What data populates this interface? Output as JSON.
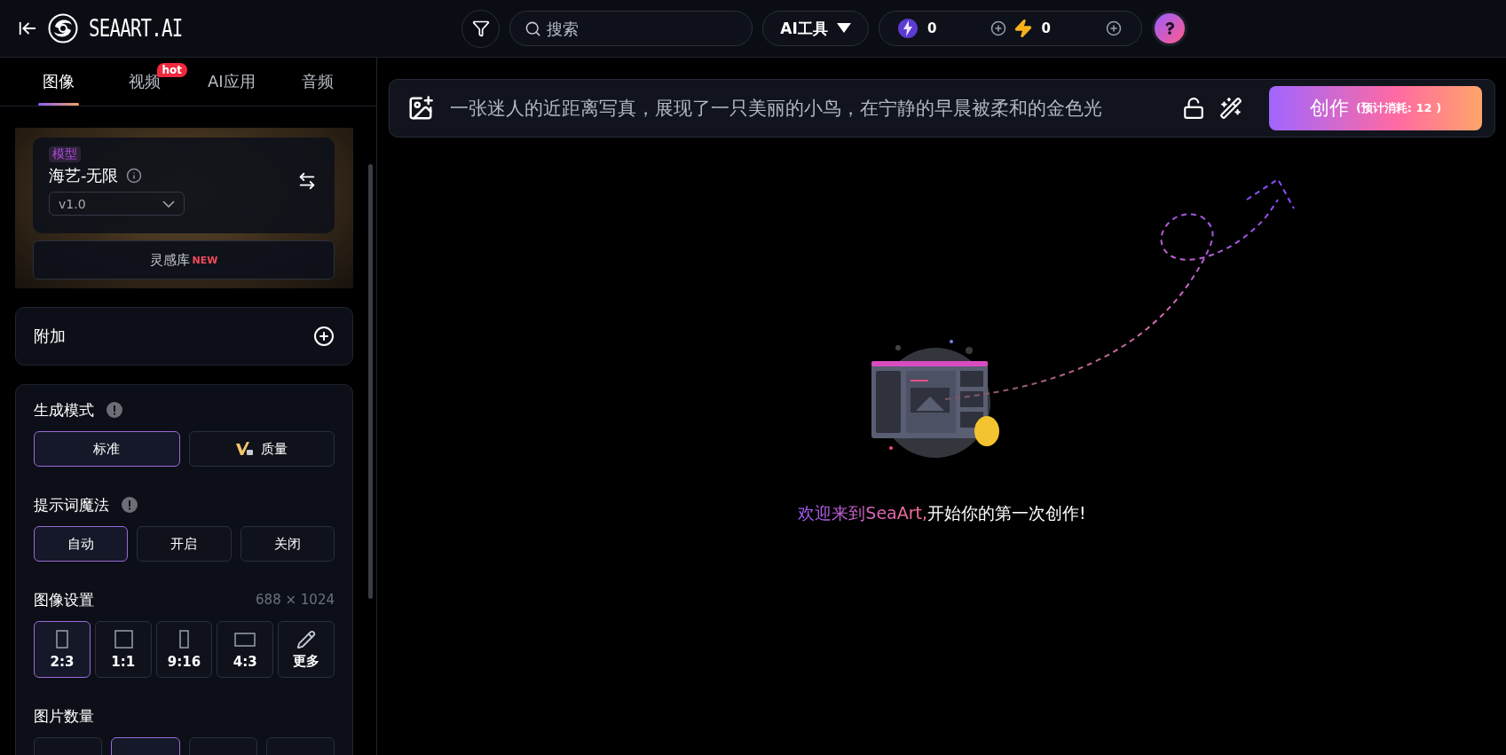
{
  "header": {
    "logo_text": "SEAART.AI",
    "search": {
      "placeholder": "搜索"
    },
    "ai_tools": "AI工具",
    "credits": [
      {
        "kind": "purple",
        "amount": "0"
      },
      {
        "kind": "gold",
        "amount": "0"
      }
    ]
  },
  "sidebar": {
    "tabs": [
      {
        "label": "图像",
        "selected": true
      },
      {
        "label": "视频",
        "selected": false,
        "badge": "hot"
      },
      {
        "label": "AI应用",
        "selected": false
      },
      {
        "label": "音频",
        "selected": false
      }
    ],
    "model": {
      "tag": "模型",
      "name": "海艺-无限",
      "version": "v1.0",
      "library": "灵感库",
      "library_badge": "NEW"
    },
    "extra": {
      "label": "附加"
    },
    "mode": {
      "label": "生成模式",
      "options": [
        {
          "label": "标准",
          "selected": true,
          "vip": false
        },
        {
          "label": "质量",
          "selected": false,
          "vip": true
        }
      ]
    },
    "prompt_magic": {
      "label": "提示词魔法",
      "options": [
        {
          "label": "自动",
          "selected": true
        },
        {
          "label": "开启",
          "selected": false
        },
        {
          "label": "关闭",
          "selected": false
        }
      ]
    },
    "image_settings": {
      "label": "图像设置",
      "size": "688 × 1024",
      "ratios": [
        {
          "label": "2:3",
          "kind": "portrait",
          "selected": true
        },
        {
          "label": "1:1",
          "kind": "square",
          "selected": false
        },
        {
          "label": "9:16",
          "kind": "tall",
          "selected": false
        },
        {
          "label": "4:3",
          "kind": "landscape",
          "selected": false
        },
        {
          "label": "更多",
          "kind": "custom",
          "selected": false
        }
      ]
    },
    "image_count": {
      "label": "图片数量",
      "options": [
        {
          "selected": false
        },
        {
          "selected": true
        },
        {
          "selected": false
        },
        {
          "selected": false
        }
      ]
    }
  },
  "prompt": {
    "value": "一张迷人的近距离写真，展现了一只美丽的小鸟，在宁静的早晨被柔和的金色光",
    "create": "创作",
    "cost": "(预计消耗: 12 )"
  },
  "welcome": {
    "highlight": "欢迎来到SeaArt,",
    "rest": "开始你的第一次创作!"
  }
}
